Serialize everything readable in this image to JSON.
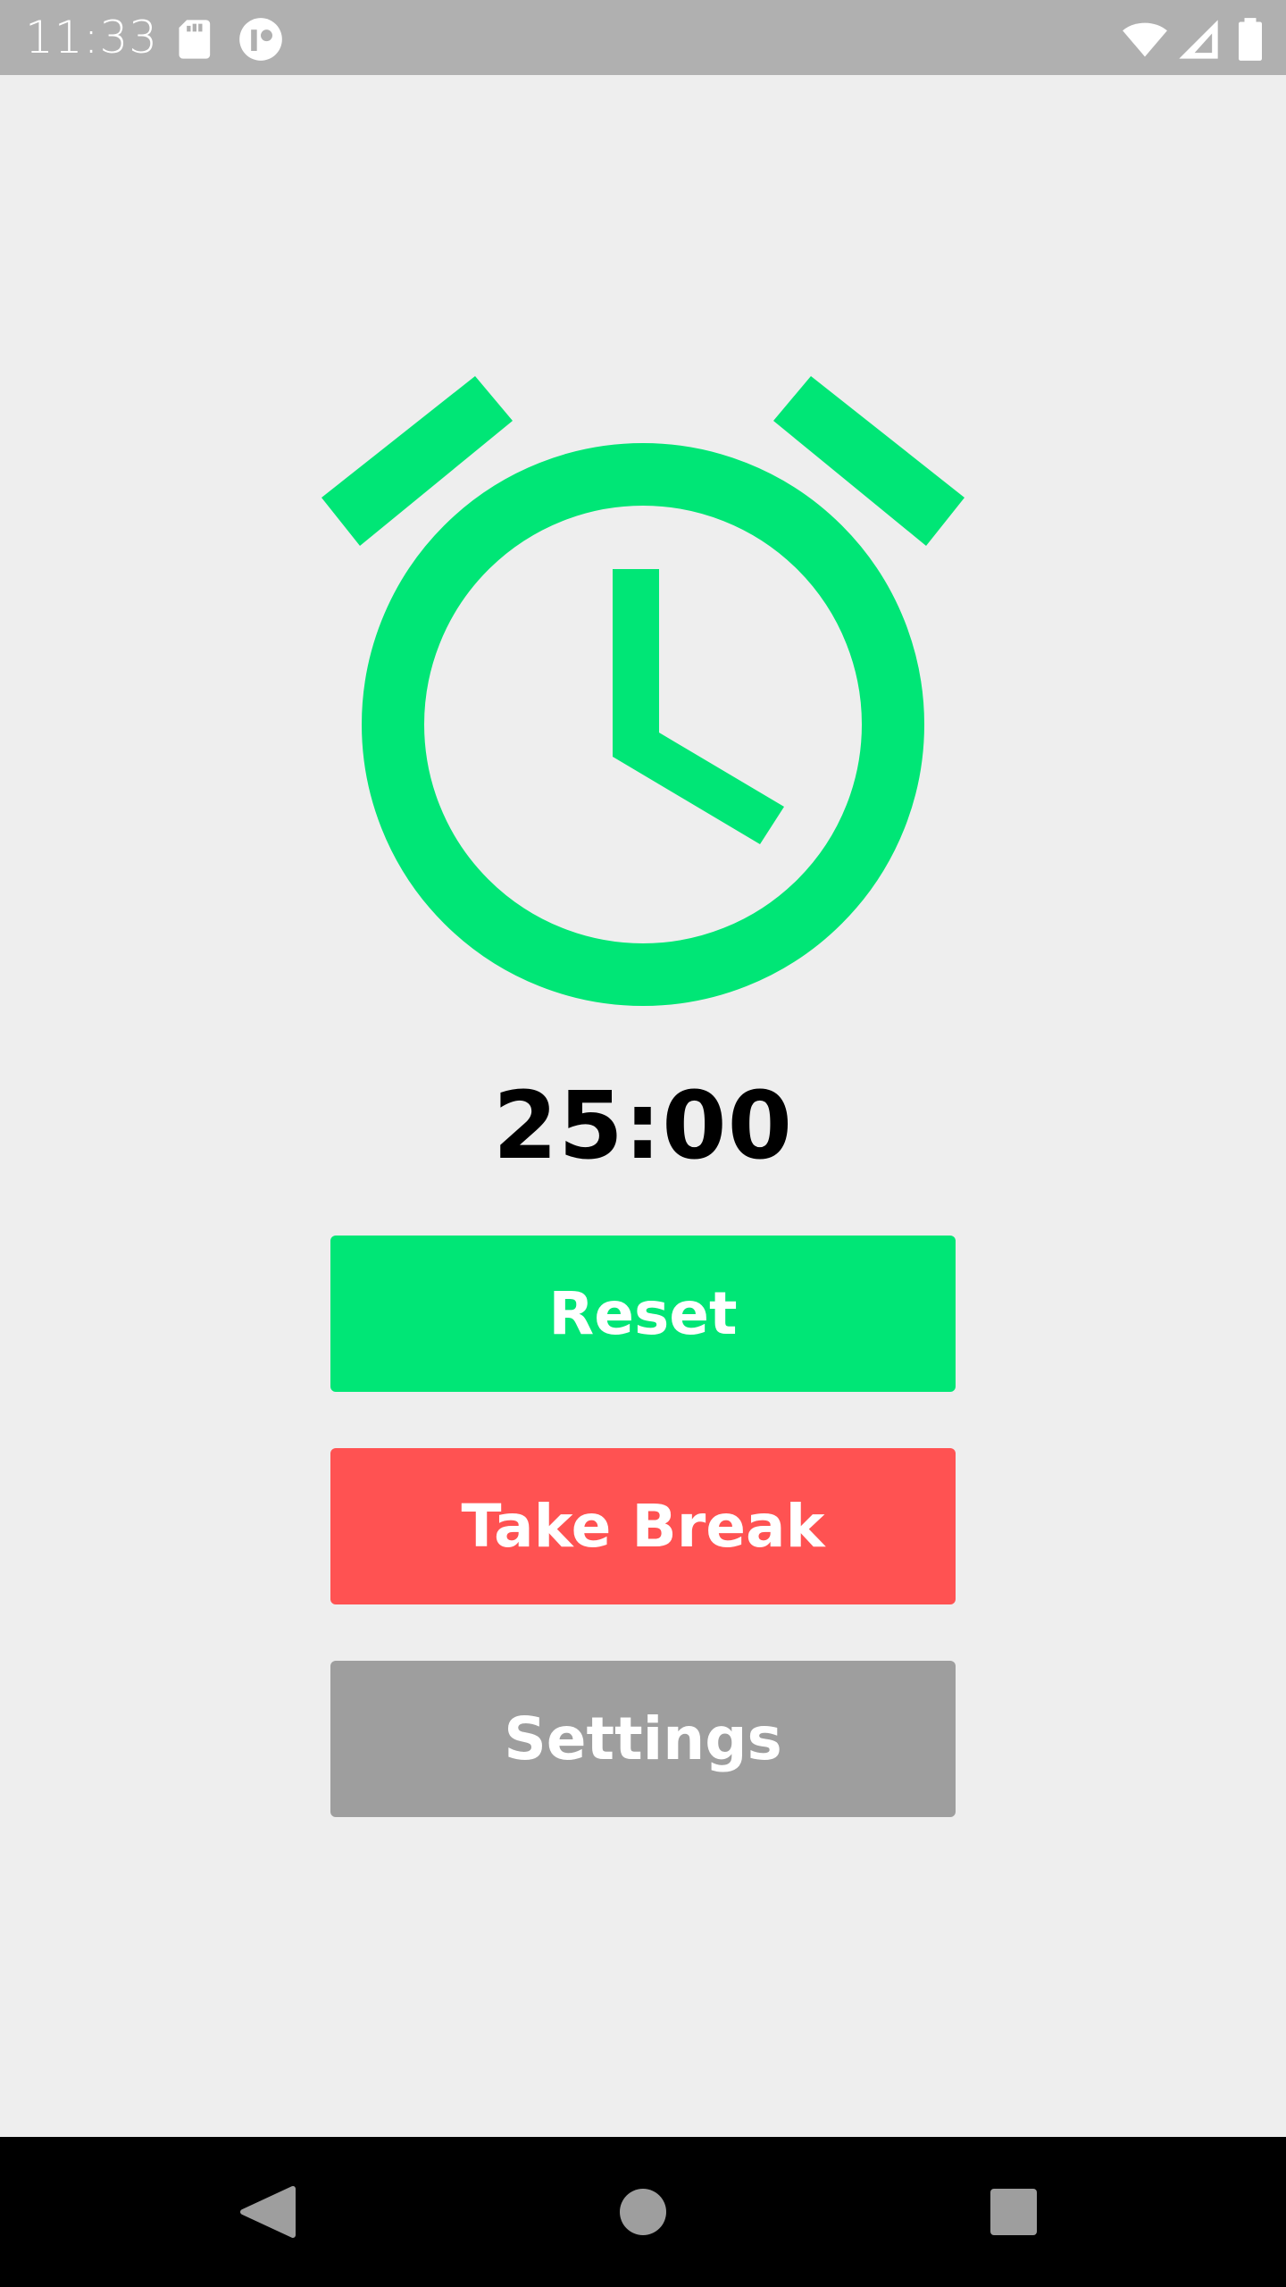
{
  "status_bar": {
    "time": "11:33",
    "icons": [
      "sd-card-icon",
      "notification-app-icon",
      "wifi-icon",
      "signal-icon",
      "battery-icon"
    ]
  },
  "timer": {
    "display": "25:00",
    "icon": "alarm-clock-icon",
    "icon_color": "#00e676"
  },
  "buttons": {
    "reset": "Reset",
    "take_break": "Take Break",
    "settings": "Settings"
  },
  "colors": {
    "reset": "#00e676",
    "take_break": "#ff5252",
    "settings": "#9e9e9e",
    "background": "#eeeeee"
  },
  "nav_bar": {
    "icons": [
      "back-icon",
      "home-icon",
      "recents-icon"
    ]
  }
}
